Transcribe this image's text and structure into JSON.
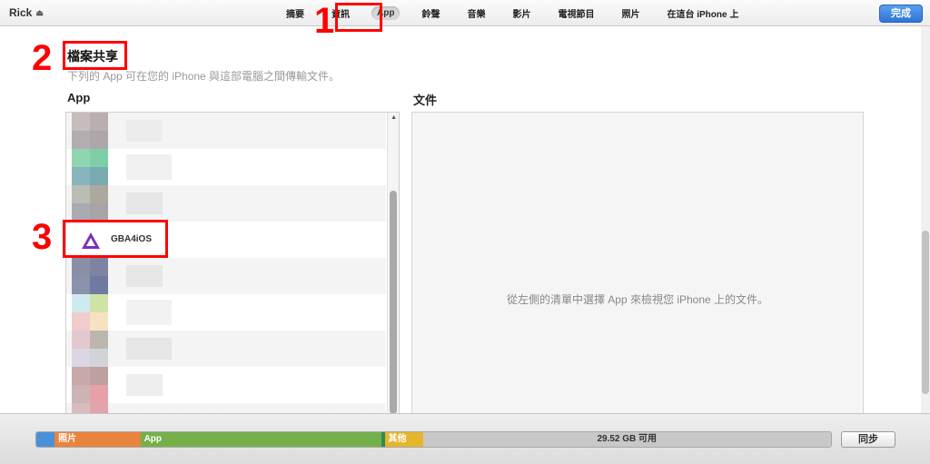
{
  "topbar": {
    "device_name": "Rick",
    "eject_icon": "eject-icon",
    "tabs": [
      "摘要",
      "資訊",
      "App",
      "鈴聲",
      "音樂",
      "影片",
      "電視節目",
      "照片",
      "在這台 iPhone 上"
    ],
    "active_tab": "App",
    "done_label": "完成",
    "done_color": "#2f74d8"
  },
  "file_sharing": {
    "title": "檔案共享",
    "subtitle": "下列的 App 可在您的 iPhone 與這部電腦之間傳輸文件。",
    "apps_header": "App",
    "documents_header": "文件",
    "selected_app": "GBA4iOS",
    "documents_empty": "從左側的清單中選擇 App 來檢視您 iPhone 上的文件。"
  },
  "annotations": [
    "1",
    "2",
    "3"
  ],
  "annotation_color": "#ff0000",
  "capacity": {
    "segments": [
      {
        "label": "",
        "color": "#4a90d9",
        "fraction": 0.023
      },
      {
        "label": "照片",
        "color": "#e8843c",
        "fraction": 0.108
      },
      {
        "label": "App",
        "color": "#74b04a",
        "fraction": 0.303
      },
      {
        "label": "",
        "color": "#2f8a52",
        "fraction": 0.004
      },
      {
        "label": "其他",
        "color": "#e6b52e",
        "fraction": 0.048
      }
    ],
    "free_label": "29.52 GB 可用",
    "free_color": "#c8c8c8"
  },
  "sync_label": "同步"
}
